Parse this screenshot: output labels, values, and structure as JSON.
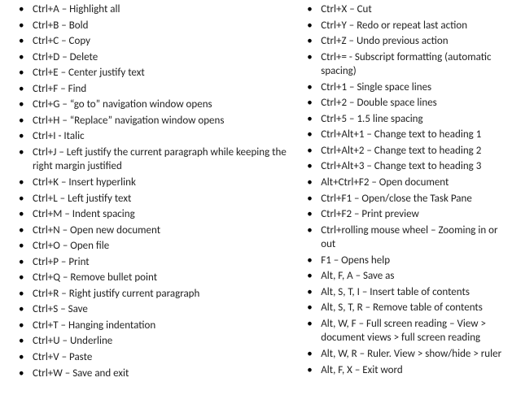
{
  "left": [
    "Ctrl+A – Highlight all",
    "Ctrl+B – Bold",
    "Ctrl+C – Copy",
    "Ctrl+D – Delete",
    "Ctrl+E – Center justify text",
    "Ctrl+F – Find",
    "Ctrl+G – “go to” navigation window opens",
    "Ctrl+H – “Replace” navigation window opens",
    "Ctrl+I - Italic",
    "Ctrl+J – Left justify the current paragraph while keeping the right margin justified",
    "Ctrl+K – Insert hyperlink",
    "Ctrl+L – Left justify text",
    "Ctrl+M – Indent spacing",
    "Ctrl+N – Open new document",
    "Ctrl+O – Open file",
    "Ctrl+P – Print",
    "Ctrl+Q – Remove bullet point",
    "Ctrl+R – Right justify current paragraph",
    "Ctrl+S – Save",
    "Ctrl+T – Hanging indentation",
    "Ctrl+U – Underline",
    "Ctrl+V – Paste",
    "Ctrl+W – Save and exit"
  ],
  "right": [
    "Ctrl+X – Cut",
    "Ctrl+Y – Redo or repeat last action",
    "Ctrl+Z – Undo previous action",
    "Ctrl+= - Subscript formatting (automatic spacing)",
    "Ctrl+1 – Single space lines",
    "Ctrl+2 – Double space lines",
    "Ctrl+5 – 1.5 line spacing",
    "Ctrl+Alt+1 – Change text to heading 1",
    "Ctrl+Alt+2 – Change text to heading 2",
    "Ctrl+Alt+3 – Change text to heading 3",
    "Alt+Ctrl+F2 – Open document",
    "Ctrl+F1 – Open/close the Task Pane",
    "Ctrl+F2 – Print preview",
    "Ctrl+rolling mouse wheel – Zooming in or out",
    "F1 – Opens help",
    "Alt, F, A – Save as",
    "Alt, S, T, I – Insert table of contents",
    "Alt, S, T, R – Remove table of contents",
    "Alt, W, F – Full screen reading – View > document views > full screen reading",
    "Alt, W, R – Ruler. View > show/hide > ruler",
    "Alt, F, X – Exit word"
  ]
}
